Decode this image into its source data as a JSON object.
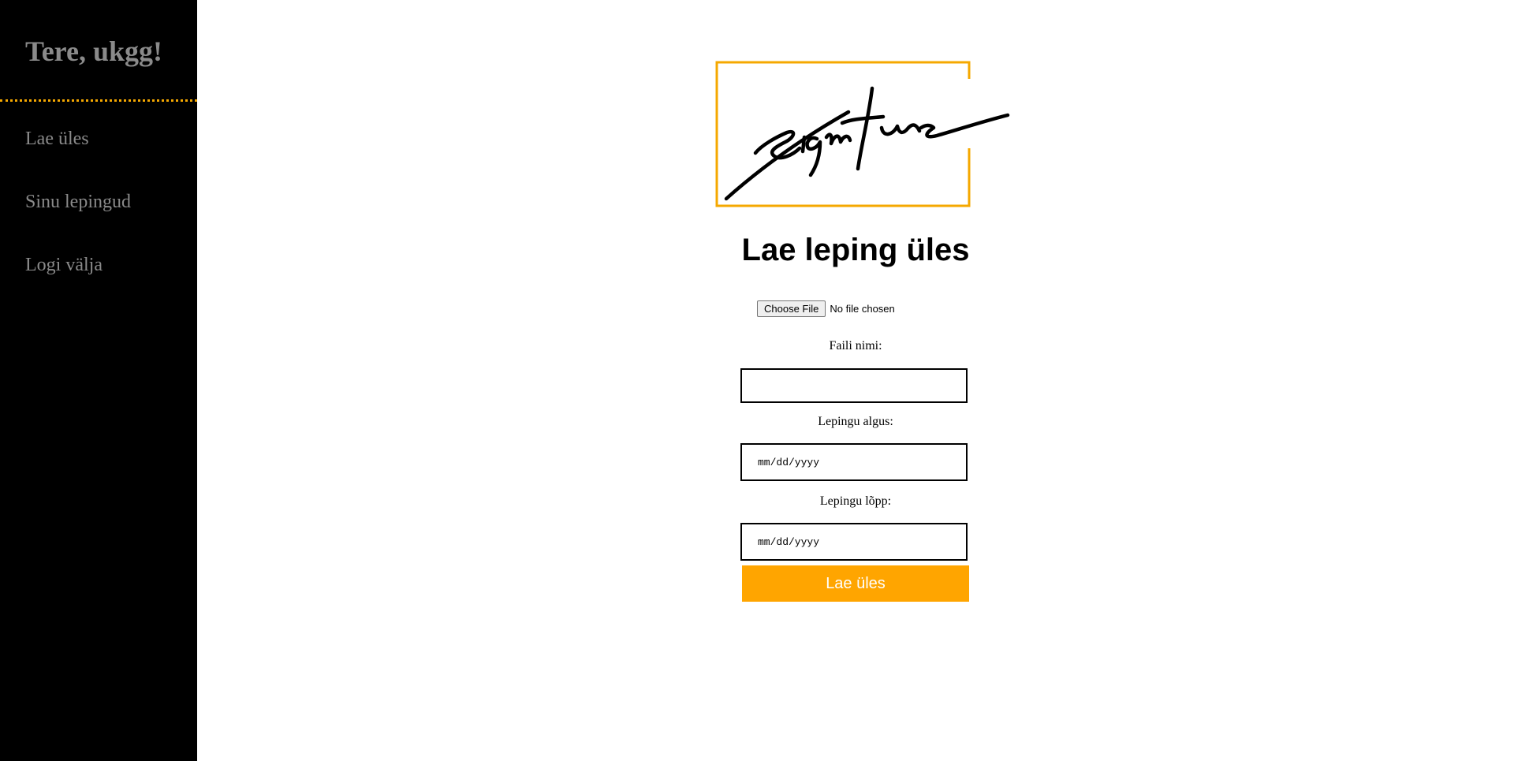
{
  "sidebar": {
    "greeting": "Tere, ukgg!",
    "items": [
      {
        "label": "Lae üles"
      },
      {
        "label": "Sinu lepingud"
      },
      {
        "label": "Logi välja"
      }
    ]
  },
  "logo": {
    "icon": "signature-logo",
    "text": "Signature"
  },
  "main": {
    "title": "Lae leping üles",
    "file_input": {
      "button_label": "Choose File",
      "status": "No file chosen"
    },
    "fields": {
      "file_name": {
        "label": "Faili nimi:",
        "value": ""
      },
      "start_date": {
        "label": "Lepingu algus:",
        "placeholder": "mm/dd/yyyy"
      },
      "end_date": {
        "label": "Lepingu lõpp:",
        "placeholder": "mm/dd/yyyy"
      }
    },
    "submit_label": "Lae üles"
  },
  "colors": {
    "sidebar_bg": "#000000",
    "sidebar_text": "#8a8a8a",
    "accent": "#ffa500"
  }
}
